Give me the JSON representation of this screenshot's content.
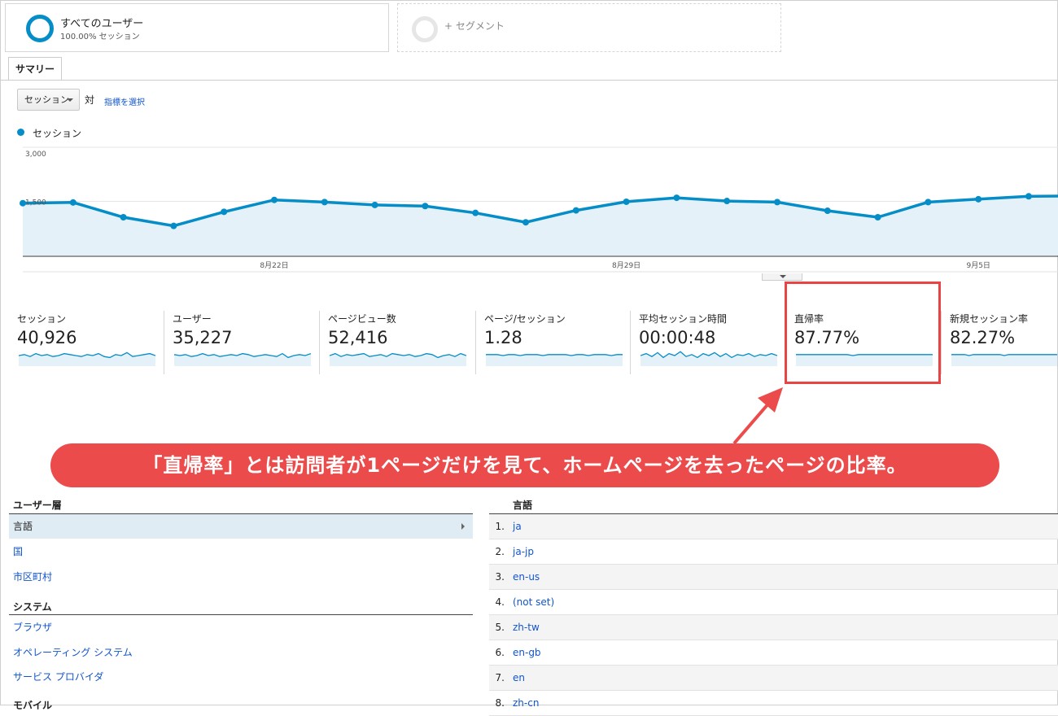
{
  "segments": {
    "all_users": {
      "title": "すべてのユーザー",
      "subtitle": "100.00% セッション"
    },
    "add_segment": "+ セグメント"
  },
  "tab": {
    "label": "サマリー"
  },
  "controls": {
    "metric_select": "セッション",
    "vs": "対",
    "select_metric_link": "指標を選択"
  },
  "legend": {
    "label": "セッション",
    "color": "#058dc7"
  },
  "chart_data": {
    "type": "line",
    "series": [
      {
        "name": "セッション",
        "values": [
          1450,
          1470,
          1060,
          820,
          1210,
          1540,
          1480,
          1400,
          1370,
          1180,
          920,
          1250,
          1490,
          1600,
          1510,
          1480,
          1240,
          1060,
          1480,
          1560,
          1640,
          1650
        ]
      }
    ],
    "y_ticks": [
      "3,000",
      "1,500"
    ],
    "x_ticks": [
      "8月22日",
      "8月29日",
      "9月5日"
    ],
    "ylim": [
      0,
      3000
    ],
    "grid": true
  },
  "metrics": [
    {
      "label": "セッション",
      "value": "40,926"
    },
    {
      "label": "ユーザー",
      "value": "35,227"
    },
    {
      "label": "ページビュー数",
      "value": "52,416"
    },
    {
      "label": "ページ/セッション",
      "value": "1.28"
    },
    {
      "label": "平均セッション時間",
      "value": "00:00:48"
    },
    {
      "label": "直帰率",
      "value": "87.77%"
    },
    {
      "label": "新規セッション率",
      "value": "82.27%"
    }
  ],
  "callout": {
    "text": "「直帰率」とは訪問者が1ページだけを見て、ホームページを去ったページの比率。",
    "color": "#ec4b4b"
  },
  "nav": {
    "demographics": {
      "heading": "ユーザー層",
      "items": [
        "言語",
        "国",
        "市区町村"
      ]
    },
    "system": {
      "heading": "システム",
      "items": [
        "ブラウザ",
        "オペレーティング システム",
        "サービス プロバイダ"
      ]
    },
    "mobile": {
      "heading": "モバイル"
    }
  },
  "table": {
    "header": "言語",
    "rows": [
      {
        "num": "1.",
        "lang": "ja"
      },
      {
        "num": "2.",
        "lang": "ja-jp"
      },
      {
        "num": "3.",
        "lang": "en-us"
      },
      {
        "num": "4.",
        "lang": "(not set)"
      },
      {
        "num": "5.",
        "lang": "zh-tw"
      },
      {
        "num": "6.",
        "lang": "en-gb"
      },
      {
        "num": "7.",
        "lang": "en"
      },
      {
        "num": "8.",
        "lang": "zh-cn"
      }
    ]
  }
}
